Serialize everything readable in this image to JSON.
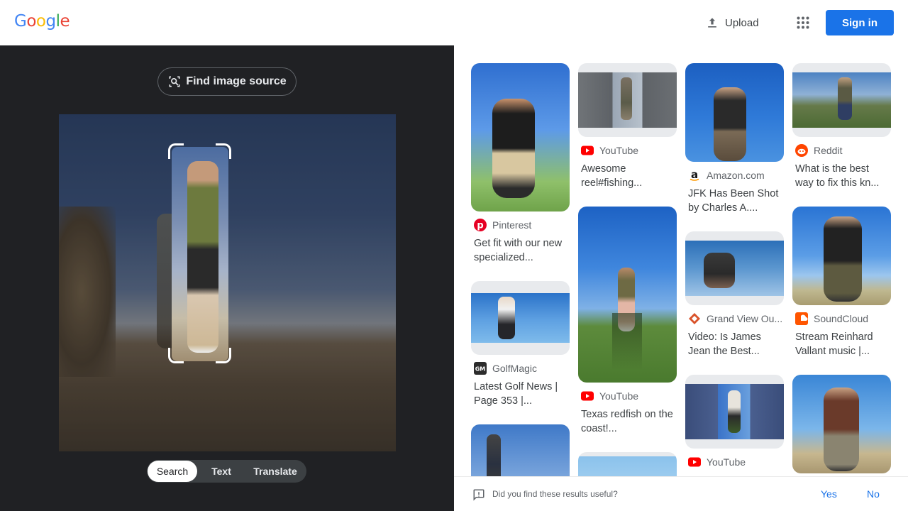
{
  "header": {
    "logo_letters": [
      "G",
      "o",
      "o",
      "g",
      "l",
      "e"
    ],
    "logo_colors": [
      "#4285F4",
      "#EA4335",
      "#FBBC05",
      "#4285F4",
      "#34A853",
      "#EA4335"
    ],
    "upload_label": "Upload",
    "signin_label": "Sign in",
    "accent": "#1a73e8"
  },
  "left": {
    "find_source_label": "Find image source",
    "modes": [
      "Search",
      "Text",
      "Translate"
    ],
    "active_mode": "Search"
  },
  "results": [
    {
      "source": "Pinterest",
      "icon": "pinterest-icon",
      "title": "Get fit with our new specialized..."
    },
    {
      "source": "YouTube",
      "icon": "youtube-icon",
      "title": "Awesome reel#fishing..."
    },
    {
      "source": "Amazon.com",
      "icon": "amazon-icon",
      "title": "JFK Has Been Shot by Charles A...."
    },
    {
      "source": "Reddit",
      "icon": "reddit-icon",
      "title": "What is the best way to fix this kn..."
    },
    {
      "source": "GolfMagic",
      "icon": "golfmagic-icon",
      "title": "Latest Golf News | Page 353 |..."
    },
    {
      "source": "YouTube",
      "icon": "youtube-icon",
      "title": "Texas redfish on the coast!..."
    },
    {
      "source": "Grand View Ou...",
      "icon": "grandview-icon",
      "title": "Video: Is James Jean the Best..."
    },
    {
      "source": "SoundCloud",
      "icon": "soundcloud-icon",
      "title": "Stream Reinhard Vallant music |..."
    },
    {
      "source": "YouTube",
      "icon": "youtube-icon",
      "title": ""
    }
  ],
  "feedback": {
    "question": "Did you find these results useful?",
    "yes": "Yes",
    "no": "No"
  }
}
